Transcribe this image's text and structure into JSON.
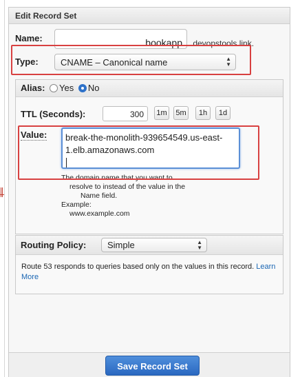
{
  "panel": {
    "title": "Edit Record Set",
    "save_label": "Save Record Set"
  },
  "name_field": {
    "label": "Name:",
    "value": "bookapp",
    "domain_suffix": ".devopstools.link."
  },
  "type_field": {
    "label": "Type:",
    "selected": "CNAME – Canonical name"
  },
  "alias": {
    "label": "Alias:",
    "options": [
      "Yes",
      "No"
    ],
    "selected": "No"
  },
  "ttl": {
    "label": "TTL (Seconds):",
    "value": "300",
    "buttons": [
      "1m",
      "5m",
      "1h",
      "1d"
    ]
  },
  "value_field": {
    "label": "Value:",
    "value": "break-the-monolith-939654549.us-east-1.elb.amazonaws.com",
    "help_line1": "The domain name that you want to",
    "help_line2": "resolve to instead of the value in the",
    "help_line3": "Name field.",
    "example_label": "Example:",
    "example_value": "www.example.com"
  },
  "routing": {
    "label": "Routing Policy:",
    "selected": "Simple",
    "description": "Route 53 responds to queries based only on the values in this record.",
    "learn_more": "Learn More"
  },
  "colors": {
    "highlight": "#d84040",
    "primary_button": "#2a68c0",
    "link": "#1a66b3"
  }
}
